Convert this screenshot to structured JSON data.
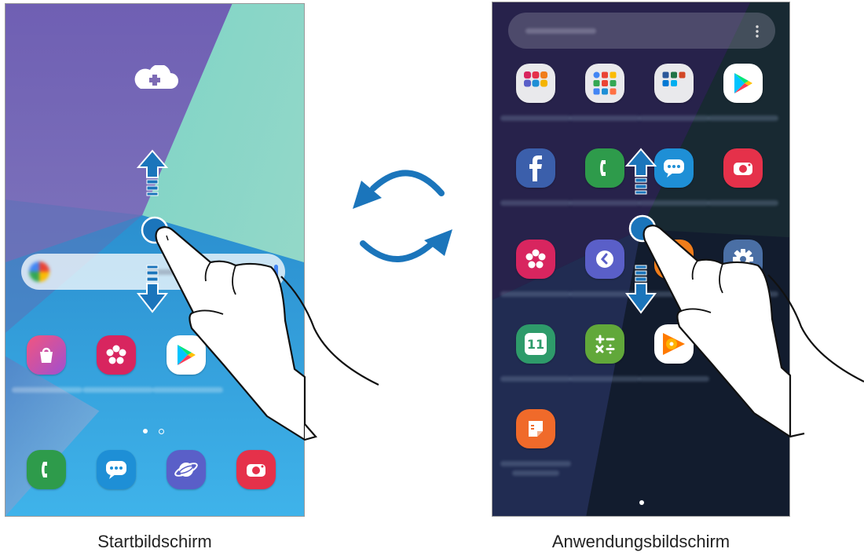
{
  "captions": {
    "home": "Startbildschirm",
    "apps": "Anwendungsbildschirm"
  },
  "home_screen": {
    "top_icon": "cloud-add-icon",
    "search_bar_icon": "google-icon",
    "apps_row": [
      "galaxy-store-icon",
      "gallery-icon",
      "play-store-icon"
    ],
    "dock": [
      "phone-icon",
      "messages-icon",
      "internet-icon",
      "camera-icon"
    ],
    "page_indicator": {
      "count": 2,
      "current": 1
    }
  },
  "apps_screen": {
    "search_menu_icon": "more-options-icon",
    "apps": [
      "samsung-folder-icon",
      "google-folder-icon",
      "microsoft-folder-icon",
      "play-store-icon",
      "facebook-icon",
      "phone-icon",
      "messages-icon",
      "camera-icon",
      "gallery-icon",
      "clock-icon",
      "galaxy-icon",
      "settings-icon",
      "calendar-icon",
      "calculator-icon",
      "play-music-icon",
      "samsung-notes-icon"
    ],
    "calendar_day": "11",
    "page_indicator": {
      "count": 1,
      "current": 1
    }
  },
  "colors": {
    "arrow_blue": "#1b75bb",
    "home_wallpaper_top": "#7d6bb5",
    "home_wallpaper_bottom": "#3aa9e6",
    "apps_background": "#1a1d3a"
  }
}
